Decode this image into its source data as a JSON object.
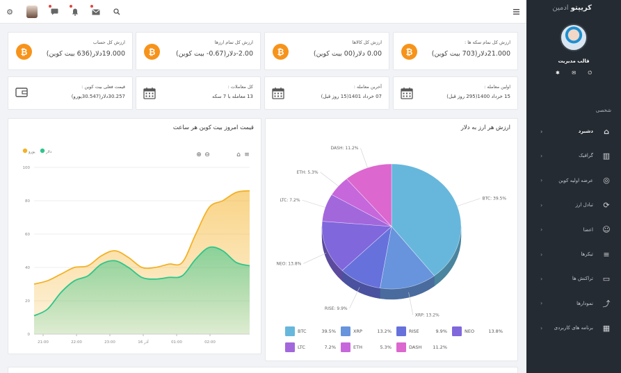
{
  "sidebar": {
    "brand_bold": "کریپتو",
    "brand_light": "ادمین",
    "profile_name": "قالب مدیریت",
    "section": "شخصی",
    "items": [
      {
        "label": "دشبرد",
        "icon": "home-icon",
        "glyph": "⌂",
        "active": true
      },
      {
        "label": "گرافیک",
        "icon": "bar-chart-icon",
        "glyph": "▥",
        "active": false
      },
      {
        "label": "عرضه اولیه کوین",
        "icon": "compass-icon",
        "glyph": "◎",
        "active": false
      },
      {
        "label": "تبادل ارز",
        "icon": "exchange-icon",
        "glyph": "⟳",
        "active": false
      },
      {
        "label": "اعضا",
        "icon": "users-icon",
        "glyph": "☺",
        "active": false
      },
      {
        "label": "تیکرها",
        "icon": "sliders-icon",
        "glyph": "≡",
        "active": false
      },
      {
        "label": "تراکنش ها",
        "icon": "folder-icon",
        "glyph": "▭",
        "active": false
      },
      {
        "label": "نمودارها",
        "icon": "trend-icon",
        "glyph": "⤴",
        "active": false
      },
      {
        "label": "برنامه های کاربردی",
        "icon": "grid-icon",
        "glyph": "▦",
        "active": false
      }
    ]
  },
  "stats_row1": [
    {
      "title": "ارزش کل نمام سکه ها :",
      "value": "21.000دلار(703 بیت کوین)"
    },
    {
      "title": "ارزش کل کالاها",
      "value": "0.00 دلار(00 بیت کوین)"
    },
    {
      "title": "ارزش کل تمام ارزها",
      "value": "2.00-دلار(0.67- بیت کوین)"
    },
    {
      "title": "ارزش کل حساب",
      "value": "19.000دلار(636 بیت کوین)"
    }
  ],
  "stats_row2": [
    {
      "title": "اولین معامله :",
      "value": "15 خرداد 1400(295 روز قبل)"
    },
    {
      "title": "آخرین معامله :",
      "value": "07 خرداد 1401(15 روز قبل)"
    },
    {
      "title": "کل معاملات :",
      "value": "13 معامله با 7 سکه"
    },
    {
      "title": "قیمت فعلی بیت کوین :",
      "value": "30.257دلار(30.547یورو)"
    }
  ],
  "pie_panel": {
    "title": "ارزش هر ارز به دلار"
  },
  "line_panel": {
    "title": "قیمت امروز بیت کوین هر ساعت"
  },
  "colors": {
    "sidebar_bg": "#252b32",
    "bitcoin": "#f7931a",
    "dollar_series": "#2ec58b",
    "euro_series": "#f4b125"
  },
  "chart_data": [
    {
      "type": "pie",
      "title": "ارزش هر ارز به دلار",
      "slices": [
        {
          "label": "BTC",
          "value": 39.5,
          "color": "#67b7dc"
        },
        {
          "label": "XRP",
          "value": 13.2,
          "color": "#6794dc"
        },
        {
          "label": "RISE",
          "value": 9.9,
          "color": "#6771dc"
        },
        {
          "label": "NEO",
          "value": 13.8,
          "color": "#8067dc"
        },
        {
          "label": "LTC",
          "value": 7.2,
          "color": "#a367dc"
        },
        {
          "label": "ETH",
          "value": 5.3,
          "color": "#c767dc"
        },
        {
          "label": "DASH",
          "value": 11.2,
          "color": "#dc67ce"
        }
      ]
    },
    {
      "type": "area",
      "title": "قیمت امروز بیت کوین هر ساعت",
      "x": [
        "21:00",
        "22:00",
        "23:00",
        "آذر 16",
        "01:00",
        "02:00"
      ],
      "ylim": [
        0,
        100
      ],
      "yticks": [
        0,
        20,
        40,
        60,
        80,
        100
      ],
      "legend": "top-left",
      "series": [
        {
          "name": "یورو",
          "color": "#f4b125",
          "values": [
            30,
            32,
            36,
            40,
            41,
            47,
            50,
            46,
            40,
            40,
            42,
            43,
            60,
            76,
            80,
            85,
            86
          ]
        },
        {
          "name": "دلار",
          "color": "#2ec58b",
          "values": [
            11,
            15,
            25,
            32,
            35,
            42,
            44,
            40,
            34,
            33,
            34,
            35,
            45,
            52,
            50,
            43,
            41
          ]
        }
      ]
    }
  ]
}
